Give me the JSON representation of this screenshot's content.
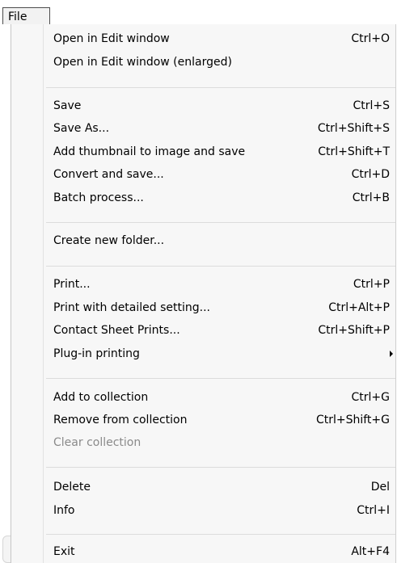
{
  "menubar": {
    "file_label": "File"
  },
  "menu": {
    "open_edit": {
      "label": "Open in Edit window",
      "shortcut": "Ctrl+O"
    },
    "open_edit_enlarged": {
      "label": "Open in Edit window (enlarged)",
      "shortcut": ""
    },
    "save": {
      "label": "Save",
      "shortcut": "Ctrl+S"
    },
    "save_as": {
      "label": "Save As...",
      "shortcut": "Ctrl+Shift+S"
    },
    "add_thumbnail": {
      "label": "Add thumbnail to image and save",
      "shortcut": "Ctrl+Shift+T"
    },
    "convert_save": {
      "label": "Convert and save...",
      "shortcut": "Ctrl+D"
    },
    "batch_process": {
      "label": "Batch process...",
      "shortcut": "Ctrl+B"
    },
    "create_folder": {
      "label": "Create new folder...",
      "shortcut": ""
    },
    "print": {
      "label": "Print...",
      "shortcut": "Ctrl+P"
    },
    "print_detailed": {
      "label": "Print with detailed setting...",
      "shortcut": "Ctrl+Alt+P"
    },
    "contact_sheet": {
      "label": "Contact Sheet Prints...",
      "shortcut": "Ctrl+Shift+P"
    },
    "plugin_printing": {
      "label": "Plug-in printing",
      "shortcut": ""
    },
    "add_collection": {
      "label": "Add to collection",
      "shortcut": "Ctrl+G"
    },
    "remove_collection": {
      "label": "Remove from collection",
      "shortcut": "Ctrl+Shift+G"
    },
    "clear_collection": {
      "label": "Clear collection",
      "shortcut": ""
    },
    "delete": {
      "label": "Delete",
      "shortcut": "Del"
    },
    "info": {
      "label": "Info",
      "shortcut": "Ctrl+I"
    },
    "exit": {
      "label": "Exit",
      "shortcut": "Alt+F4"
    }
  },
  "colors": {
    "menu_background": "#f7f7f7",
    "disabled_text": "#8a8a8a",
    "separator": "#dcdcdc"
  }
}
